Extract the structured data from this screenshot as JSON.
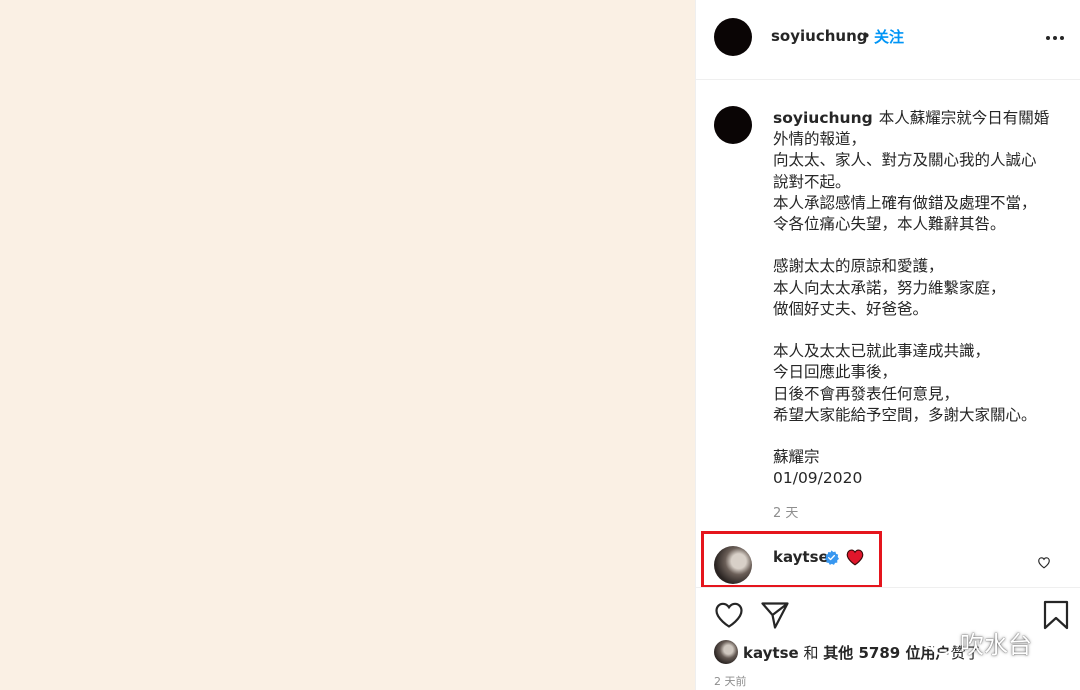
{
  "post": {
    "media_background": "#faf0e4",
    "header": {
      "username": "soyiuchung",
      "separator": "•",
      "follow_label": "关注",
      "more_icon": "more-options-icon"
    },
    "caption": {
      "username": "soyiuchung",
      "lines": [
        "本人蘇耀宗就今日有關婚",
        "外情的報道，",
        "向太太、家人、對方及關心我的人誠心",
        "說對不起。",
        "本人承認感情上確有做錯及處理不當，",
        "令各位痛心失望，本人難辭其咎。",
        "",
        "感謝太太的原諒和愛護，",
        "本人向太太承諾，努力維繫家庭，",
        "做個好丈夫、好爸爸。",
        "",
        "本人及太太已就此事達成共識，",
        "今日回應此事後，",
        "日後不會再發表任何意見，",
        "希望大家能給予空間，多謝大家關心。",
        "",
        "蘇耀宗",
        "01/09/2020"
      ],
      "timestamp": "2 天"
    },
    "comment": {
      "username": "kaytse",
      "verified": true,
      "emoji": "red-heart",
      "highlight_color": "#e5151d"
    },
    "likes": {
      "user": "kaytse",
      "connector": "和",
      "others": "其他 5789 位用户",
      "suffix": "赞了"
    },
    "timestamp_full": "2 天前",
    "watermark": "吹水台",
    "accent_color": "#0095f6"
  }
}
